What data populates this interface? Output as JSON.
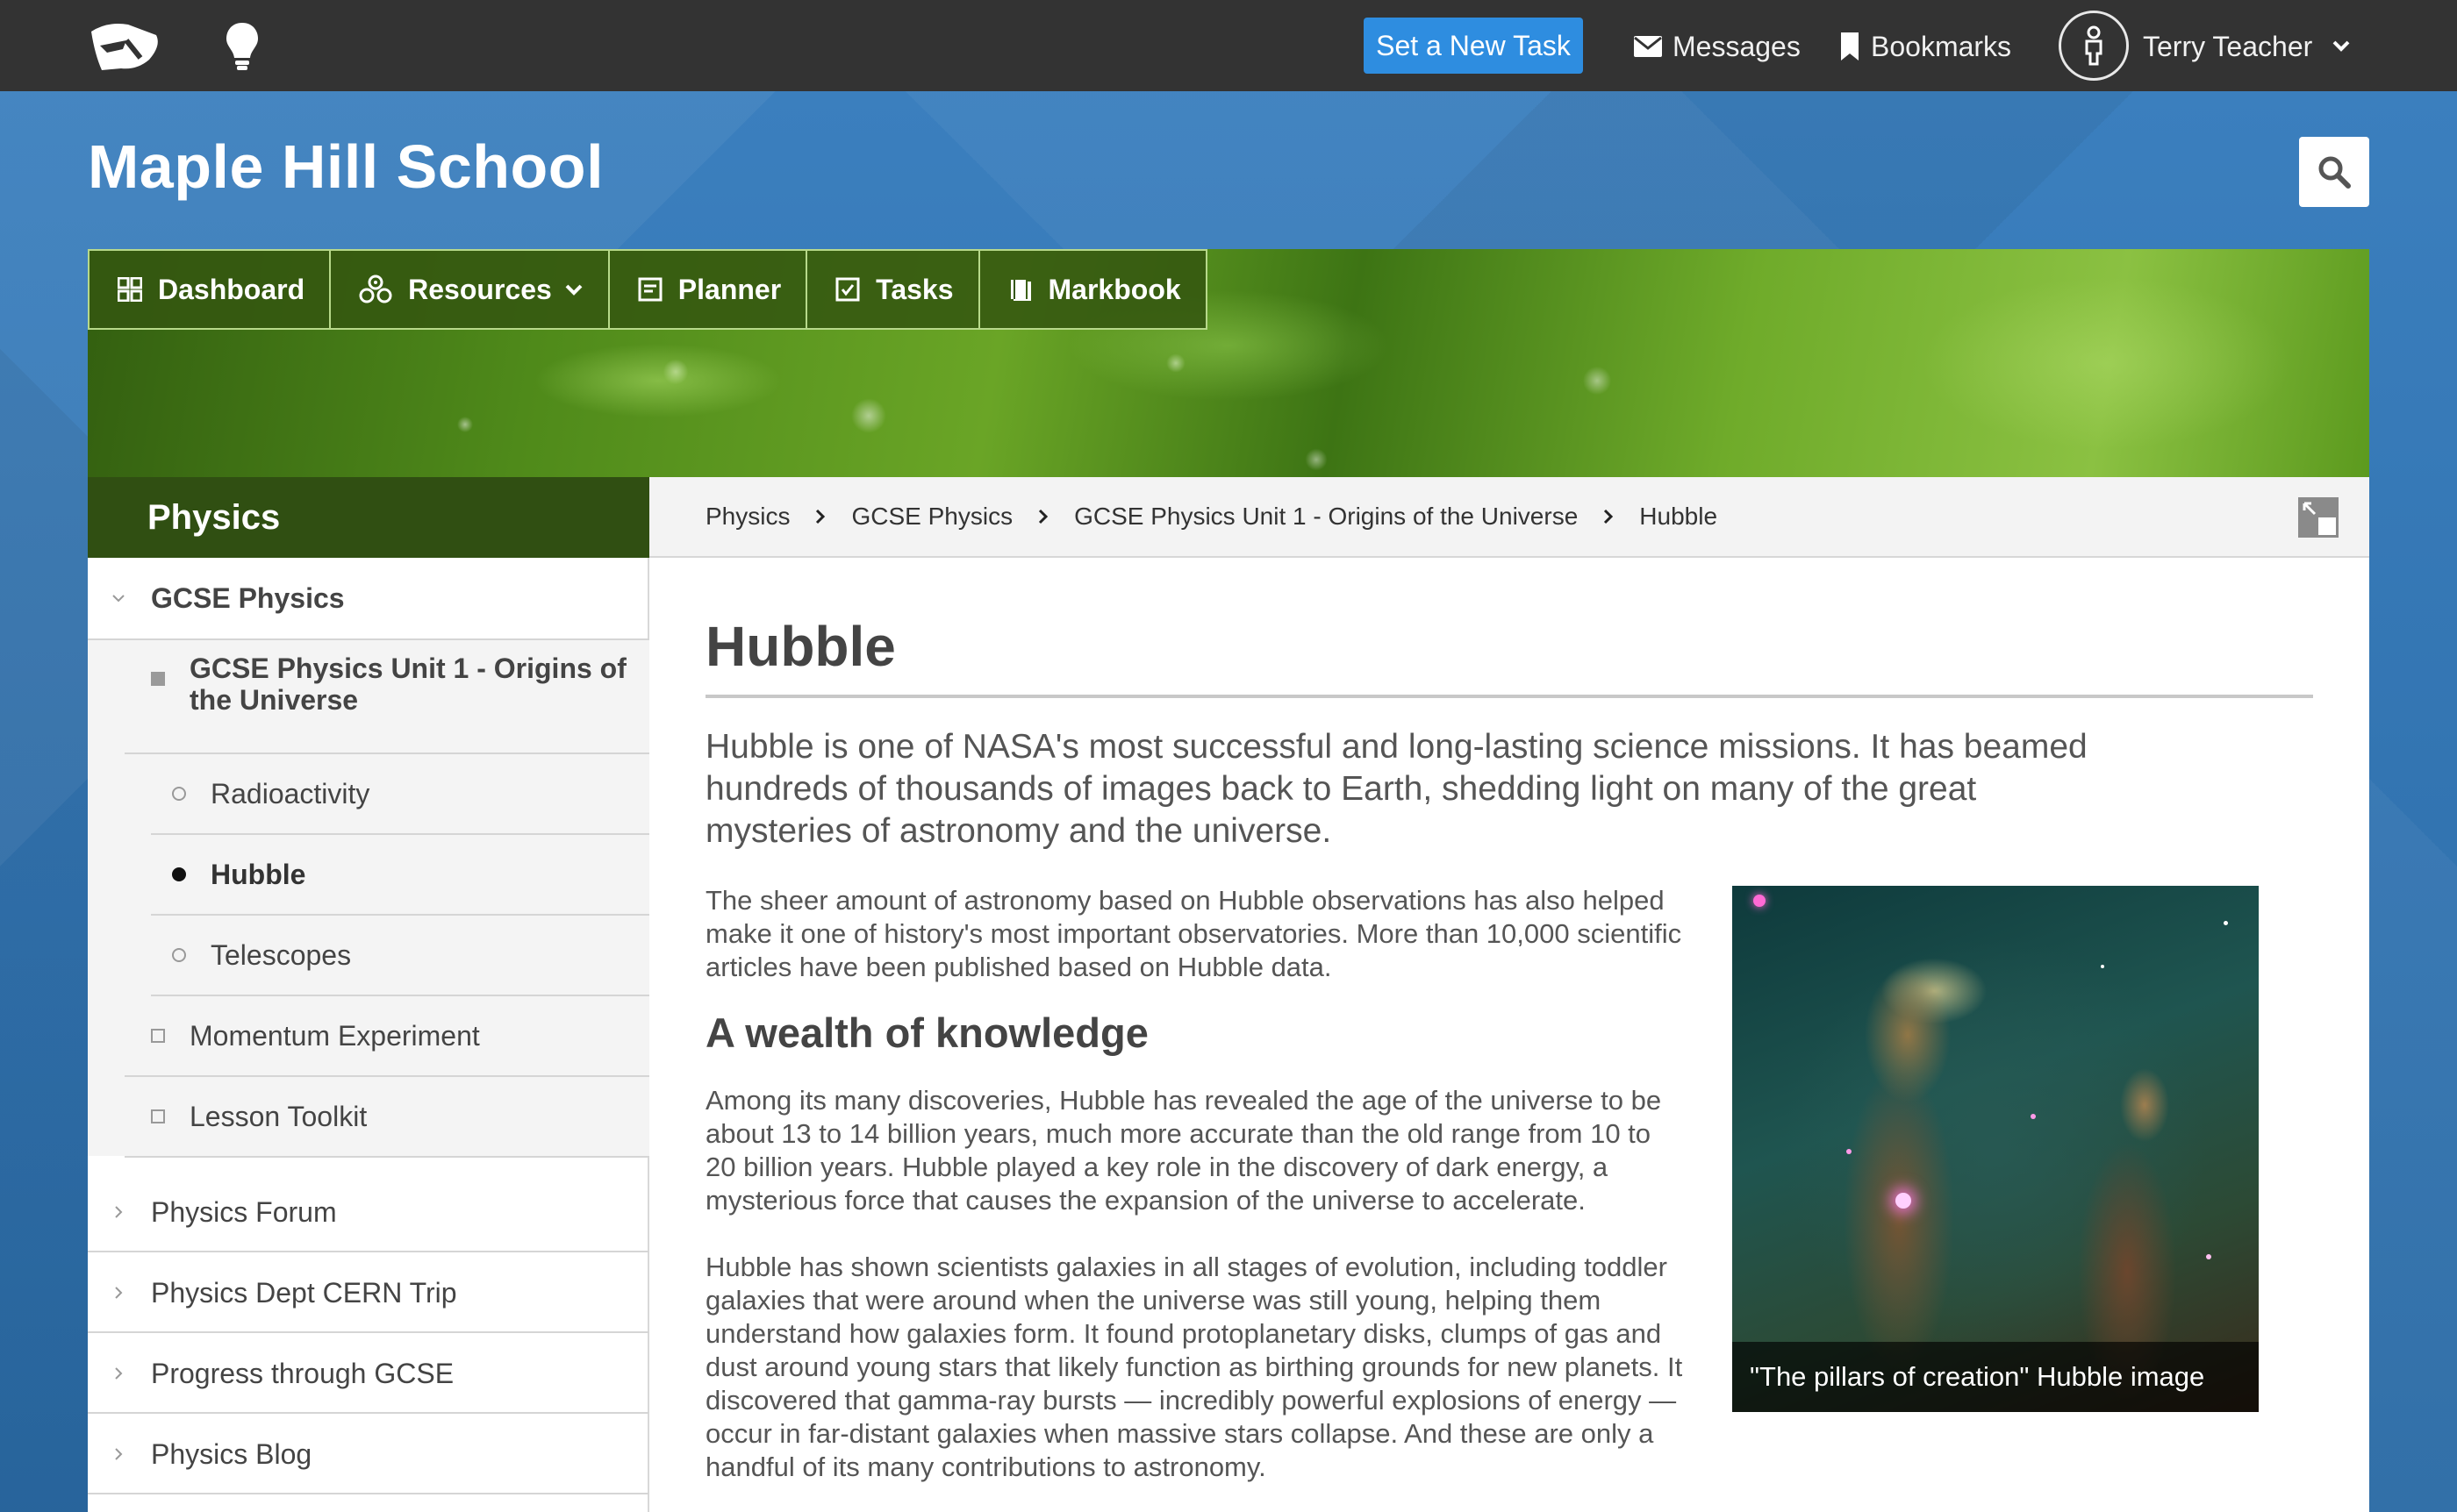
{
  "topbar": {
    "new_task_label": "Set a New Task",
    "messages_label": "Messages",
    "bookmarks_label": "Bookmarks",
    "user_name": "Terry Teacher"
  },
  "header": {
    "school_name": "Maple Hill School"
  },
  "nav": {
    "items": [
      {
        "label": "Dashboard",
        "icon": "grid-icon"
      },
      {
        "label": "Resources",
        "icon": "resources-icon"
      },
      {
        "label": "Planner",
        "icon": "planner-icon"
      },
      {
        "label": "Tasks",
        "icon": "tasks-icon"
      },
      {
        "label": "Markbook",
        "icon": "markbook-icon"
      }
    ]
  },
  "sidebar": {
    "heading": "Physics",
    "items": [
      {
        "label": "GCSE Physics",
        "marker": "chevron-down"
      },
      {
        "label": "GCSE Physics Unit 1 - Origins of the Universe",
        "marker": "filled-square"
      },
      {
        "label": "Radioactivity",
        "marker": "hollow-circle"
      },
      {
        "label": "Hubble",
        "marker": "filled-circle",
        "active": true
      },
      {
        "label": "Telescopes",
        "marker": "hollow-circle"
      },
      {
        "label": "Momentum Experiment",
        "marker": "hollow-square"
      },
      {
        "label": "Lesson Toolkit",
        "marker": "hollow-square"
      },
      {
        "label": "Physics Forum",
        "marker": "chevron-right"
      },
      {
        "label": "Physics Dept CERN Trip",
        "marker": "chevron-right"
      },
      {
        "label": "Progress through GCSE",
        "marker": "chevron-right"
      },
      {
        "label": "Physics Blog",
        "marker": "chevron-right"
      }
    ]
  },
  "breadcrumb": [
    "Physics",
    "GCSE Physics",
    "GCSE Physics Unit 1 - Origins of the Universe",
    "Hubble"
  ],
  "content": {
    "title": "Hubble",
    "lead": "Hubble is one of NASA's most successful and long-lasting science missions. It has beamed hundreds of thousands of images back to Earth, shedding light on many of the great mysteries of astronomy and the universe.",
    "para1": "The sheer amount of astronomy based on Hubble observations has also helped make it one of history's most important observatories. More than 10,000 scientific articles have been published based on Hubble data.",
    "subheading": "A wealth of knowledge",
    "para2": "Among its many discoveries, Hubble has revealed the age of the universe to be about 13 to 14 billion years, much more accurate than the old range from 10 to 20 billion years. Hubble played a key role in the discovery of dark energy, a mysterious force that causes the expansion of the universe to accelerate.",
    "para3": "Hubble has shown scientists galaxies in all stages of evolution, including toddler galaxies that were around when the universe was still young, helping them understand how galaxies form. It found protoplanetary disks, clumps of gas and dust around young stars that likely function as birthing grounds for new planets. It discovered that gamma-ray bursts — incredibly powerful explosions of energy — occur in far-distant galaxies when massive stars collapse. And these are only a handful of its many contributions to astronomy.",
    "image_caption": "\"The pillars of creation\" Hubble image"
  },
  "colors": {
    "topbar": "#333333",
    "accent_button": "#2e8de0",
    "nav_green": "#345610",
    "sidebar_head": "#304f12",
    "background_blue": "#2f6fa8"
  }
}
